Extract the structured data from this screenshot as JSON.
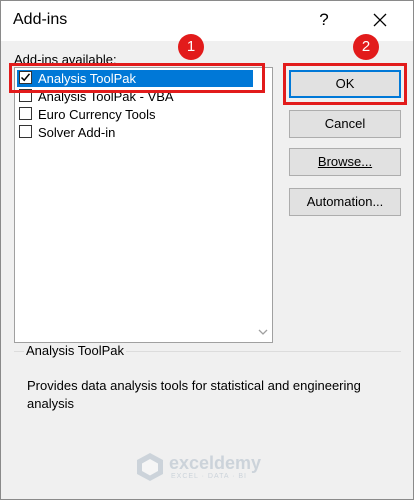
{
  "dialog": {
    "title": "Add-ins",
    "help_glyph": "?",
    "list_label": "Add-ins available:",
    "addins": [
      {
        "label": "Analysis ToolPak",
        "checked": true,
        "selected": true
      },
      {
        "label": "Analysis ToolPak - VBA",
        "checked": false,
        "selected": false
      },
      {
        "label": "Euro Currency Tools",
        "checked": false,
        "selected": false
      },
      {
        "label": "Solver Add-in",
        "checked": false,
        "selected": false
      }
    ],
    "buttons": {
      "ok": "OK",
      "cancel": "Cancel",
      "browse": "Browse...",
      "automation": "Automation..."
    },
    "info": {
      "title": "Analysis ToolPak",
      "description": "Provides data analysis tools for statistical and engineering analysis"
    }
  },
  "annotations": {
    "step1": "1",
    "step2": "2",
    "color": "#e21b1b"
  },
  "watermark": {
    "brand": "exceldemy",
    "tagline": "EXCEL · DATA · BI"
  },
  "colors": {
    "selection": "#0078d7",
    "dialog_bg": "#f0f0f0"
  }
}
